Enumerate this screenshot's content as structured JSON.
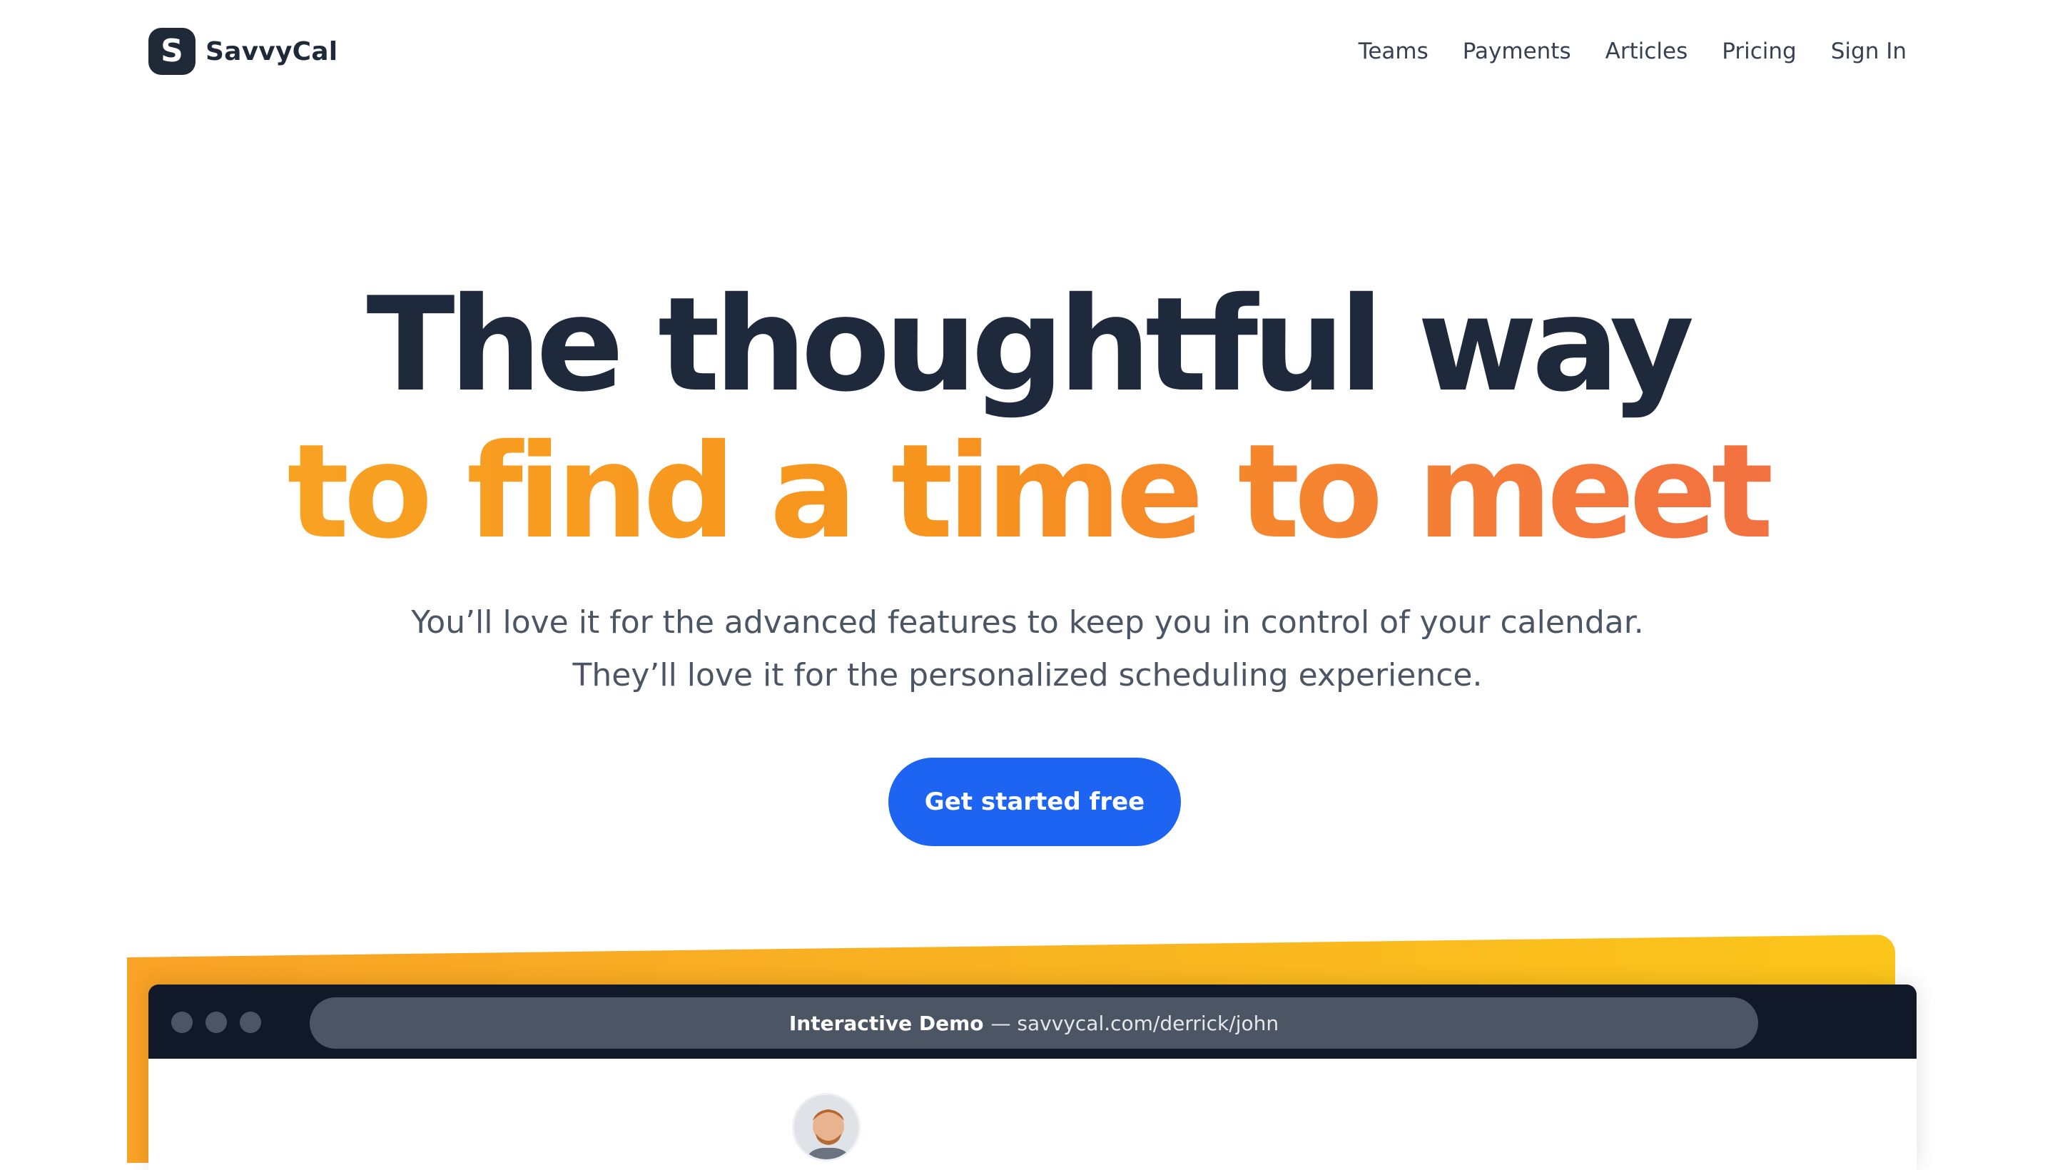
{
  "logo": {
    "mark": "S",
    "name": "SavvyCal"
  },
  "nav": {
    "items": [
      "Teams",
      "Payments",
      "Articles",
      "Pricing",
      "Sign In"
    ]
  },
  "hero": {
    "title_line1": "The thoughtful way",
    "title_line2": "to find a time to meet",
    "subtitle_line1": "You’ll love it for the advanced features to keep you in control of your calendar.",
    "subtitle_line2": "They’ll love it for the personalized scheduling experience.",
    "cta_label": "Get started free"
  },
  "demo": {
    "url_label": "Interactive Demo",
    "url_text": "— savvycal.com/derrick/john"
  },
  "colors": {
    "brand_dark": "#1e293b",
    "accent_orange": "#f7941d",
    "accent_coral": "#f0654a",
    "cta_blue": "#1d64f2",
    "backdrop_yellow": "#fbc51a"
  },
  "icons": [
    "logo-icon",
    "window-dot-icon",
    "avatar"
  ]
}
